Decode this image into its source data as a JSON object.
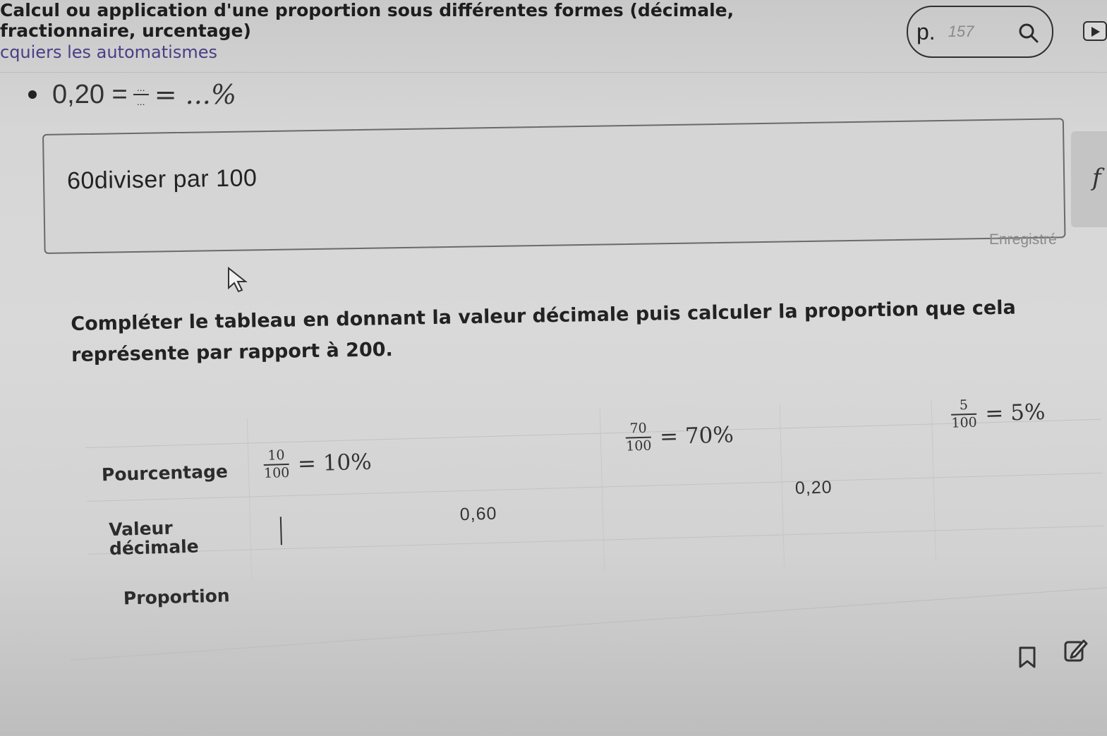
{
  "header": {
    "title": "Calcul ou application d'une proportion sous différentes formes (décimale, fractionnaire, urcentage)",
    "subtitle": "cquiers les automatismes"
  },
  "page_search": {
    "prefix": "p.",
    "value": "157",
    "search_icon": "search-icon"
  },
  "play_icon": "play-icon",
  "automatism": {
    "expression_left": "0,20 =",
    "frac_num": "...",
    "frac_den": "...",
    "expression_right": "= ...%"
  },
  "answer_box": {
    "text": "60diviser par 100",
    "formula_tab": "f",
    "status": "Enregistré"
  },
  "instruction": "Compléter le tableau en donnant la valeur décimale  puis calculer la proportion que cela représente par rapport à 200.",
  "table": {
    "rows": [
      "Pourcentage",
      "Valeur décimale",
      "Proportion"
    ],
    "percent_cells": [
      {
        "num": "10",
        "den": "100",
        "rest": "= 10%"
      },
      {
        "num": "70",
        "den": "100",
        "rest": "= 70%"
      },
      {
        "num": "5",
        "den": "100",
        "rest": "= 5%"
      }
    ],
    "decimal_cells": [
      "0,60",
      "0,20"
    ]
  },
  "footer": {
    "bookmark_icon": "bookmark-icon",
    "edit_icon": "edit-icon"
  }
}
